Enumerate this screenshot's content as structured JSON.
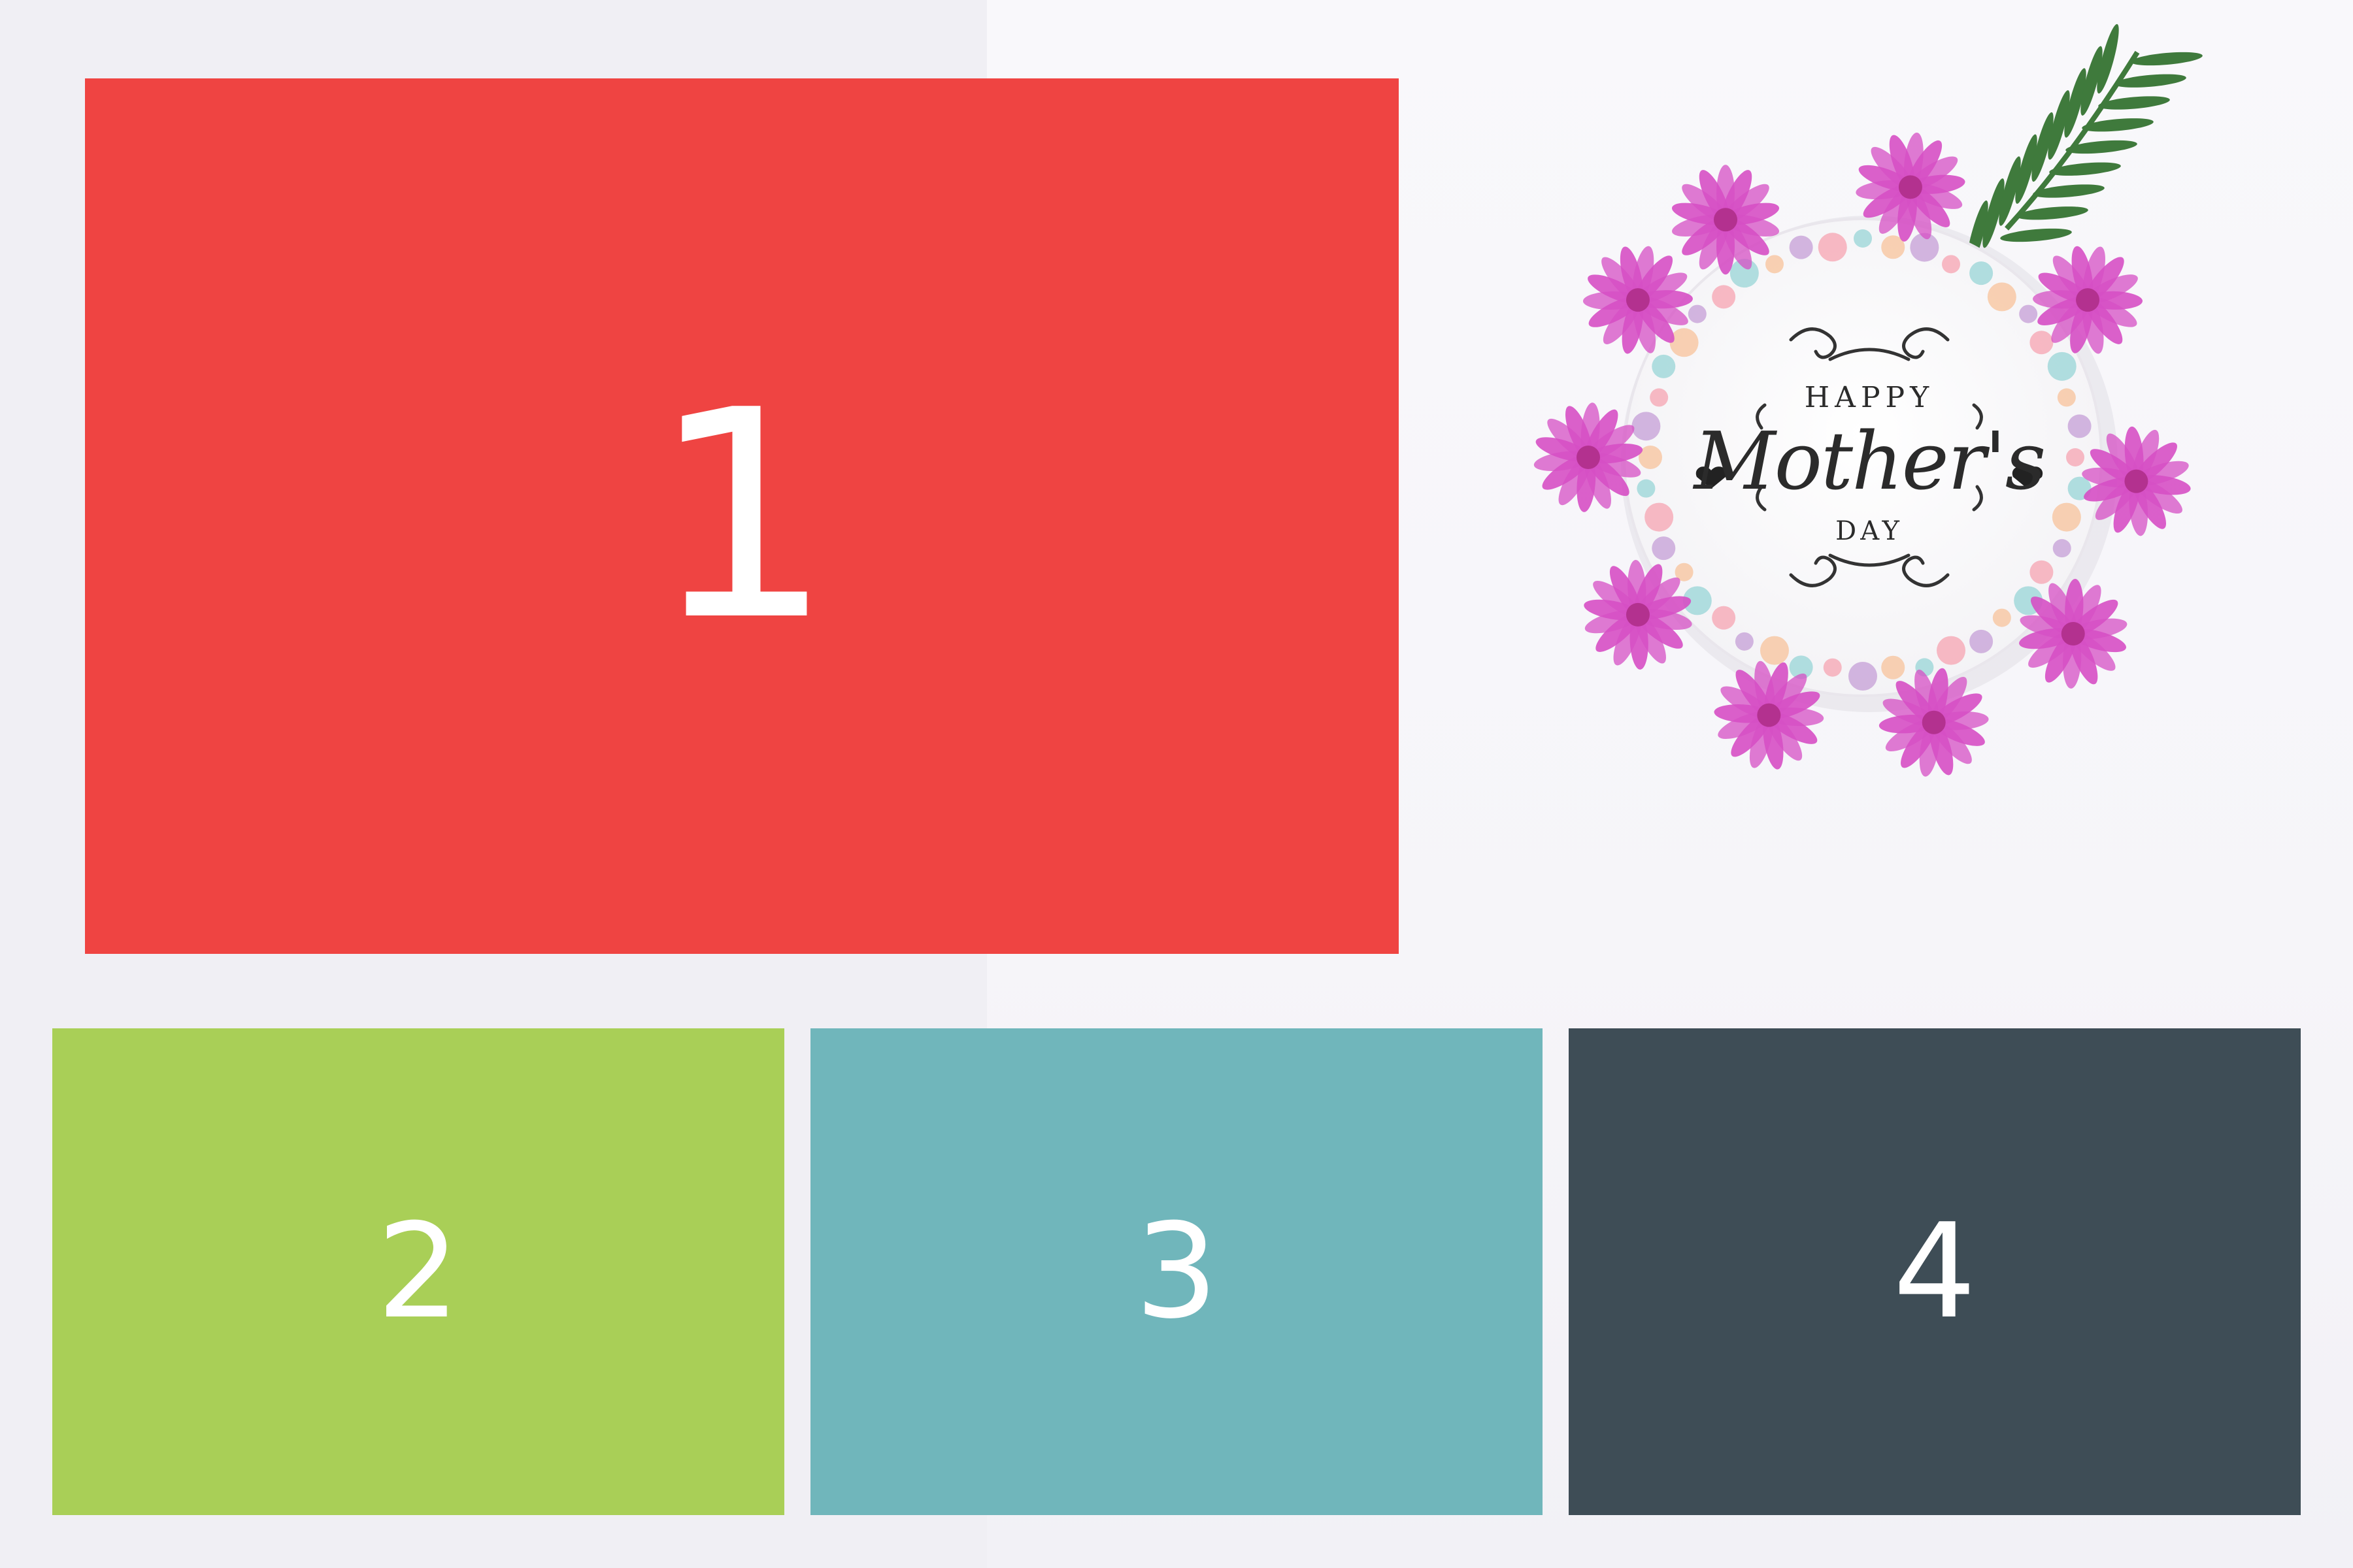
{
  "tiles": [
    {
      "label": "1",
      "color": "#ef4442"
    },
    {
      "label": "2",
      "color": "#a9cf57"
    },
    {
      "label": "3",
      "color": "#70b6bb"
    },
    {
      "label": "4",
      "color": "#3e4d56"
    }
  ],
  "card": {
    "line1": "HAPPY",
    "line2": "Mother's",
    "line3": "DAY",
    "flower_color": "#d64fc4",
    "leaf_color": "#3f7a3c"
  }
}
